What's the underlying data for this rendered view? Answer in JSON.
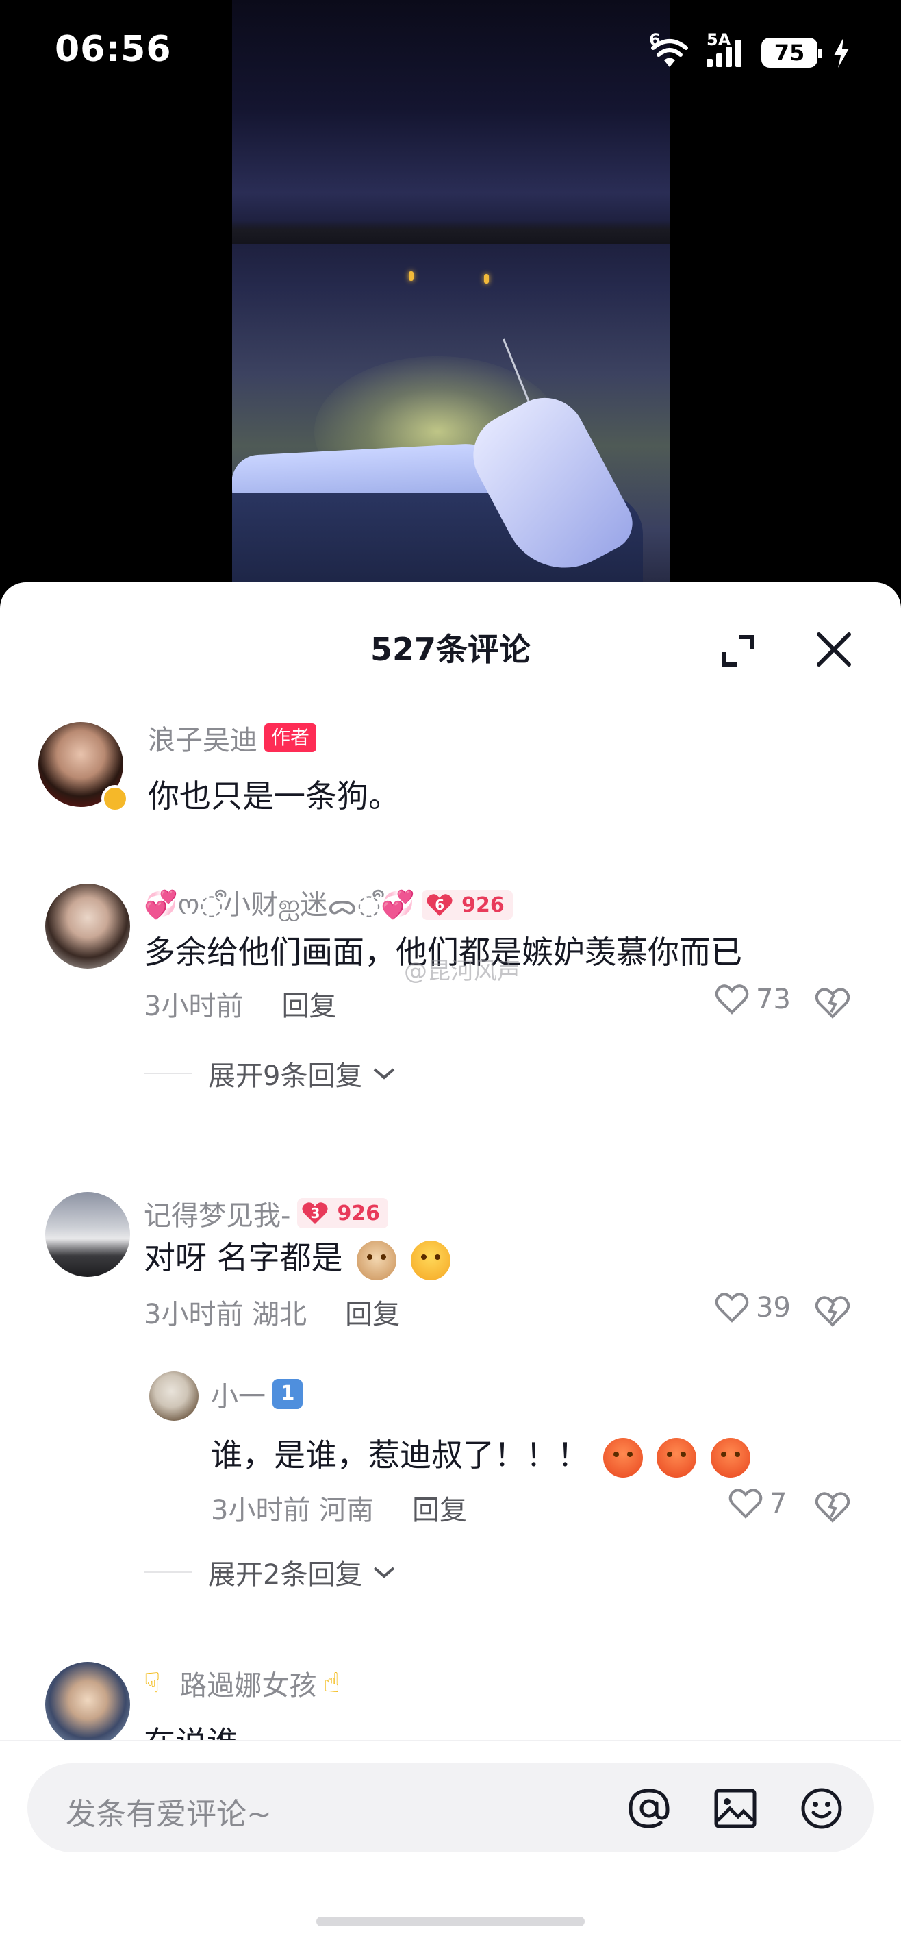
{
  "status_bar": {
    "time": "06:56",
    "network_1": "6",
    "network_2": "5A",
    "battery": "75"
  },
  "sheet": {
    "title": "527条评论"
  },
  "comments": [
    {
      "username": "浪子吴迪",
      "author_badge": "作者",
      "text": "你也只是一条狗。"
    },
    {
      "username": "💞ო◌ᩙ小财ஐ迷ᯅ◌ᩙ💞",
      "fan_level": "6",
      "fan_count": "926",
      "text": "多余给他们画面，他们都是嫉妒羡慕你而已",
      "time": "3小时前",
      "reply": "回复",
      "likes": "73",
      "expand": "展开9条回复"
    },
    {
      "username": "记得梦见我-",
      "fan_level": "3",
      "fan_count": "926",
      "text": "对呀 名字都是",
      "time": "3小时前 湖北",
      "reply": "回复",
      "likes": "39",
      "replies": [
        {
          "username": "小一",
          "level": "1",
          "text": "谁，是谁，惹迪叔了！！！",
          "time": "3小时前 河南",
          "reply": "回复",
          "likes": "7"
        }
      ],
      "expand": "展开2条回复"
    },
    {
      "username": "路過娜女孩",
      "text": "在说谁"
    }
  ],
  "watermark": "@昆河风声",
  "input": {
    "placeholder": "发条有爱评论~"
  },
  "icons": [
    "wifi-icon",
    "signal-icon",
    "charging-icon",
    "expand-icon",
    "close-icon",
    "heart-icon",
    "dislike-icon",
    "chevron-down-icon",
    "at-icon",
    "image-icon",
    "emoji-icon"
  ],
  "colors": {
    "accent": "#fe2c55",
    "fan_badge": "#e83a5a",
    "level_badge": "#4f8fdd",
    "muted_text": "#8a8b91"
  }
}
